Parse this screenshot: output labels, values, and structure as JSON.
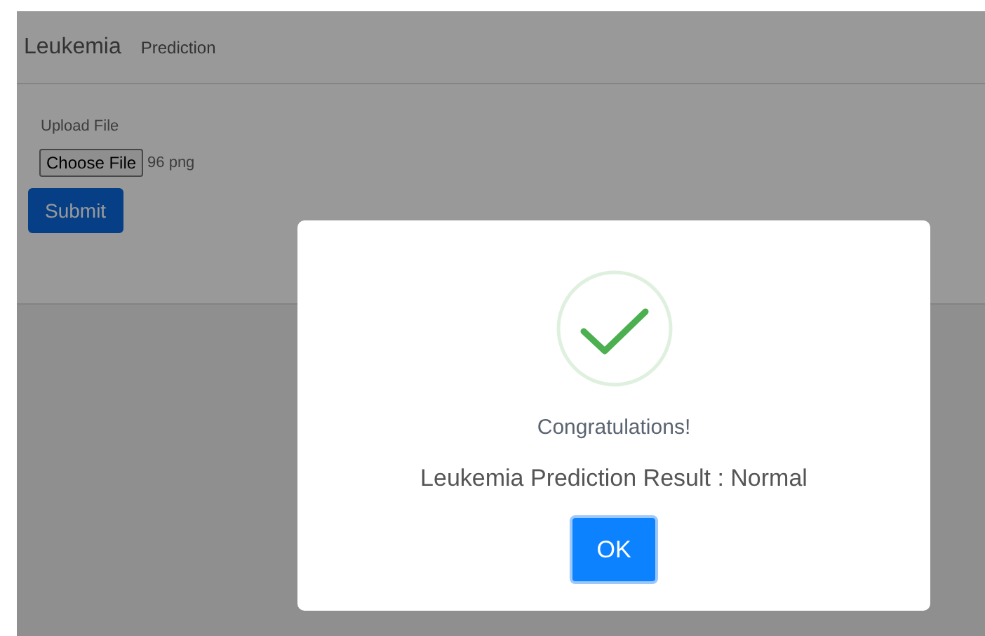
{
  "navbar": {
    "brand": "Leukemia",
    "link": "Prediction"
  },
  "form": {
    "label": "Upload File",
    "file_button": "Choose File",
    "file_name": "96 png",
    "submit": "Submit"
  },
  "dialog": {
    "title": "Congratulations!",
    "message": "Leukemia Prediction Result : Normal",
    "button": "OK"
  }
}
